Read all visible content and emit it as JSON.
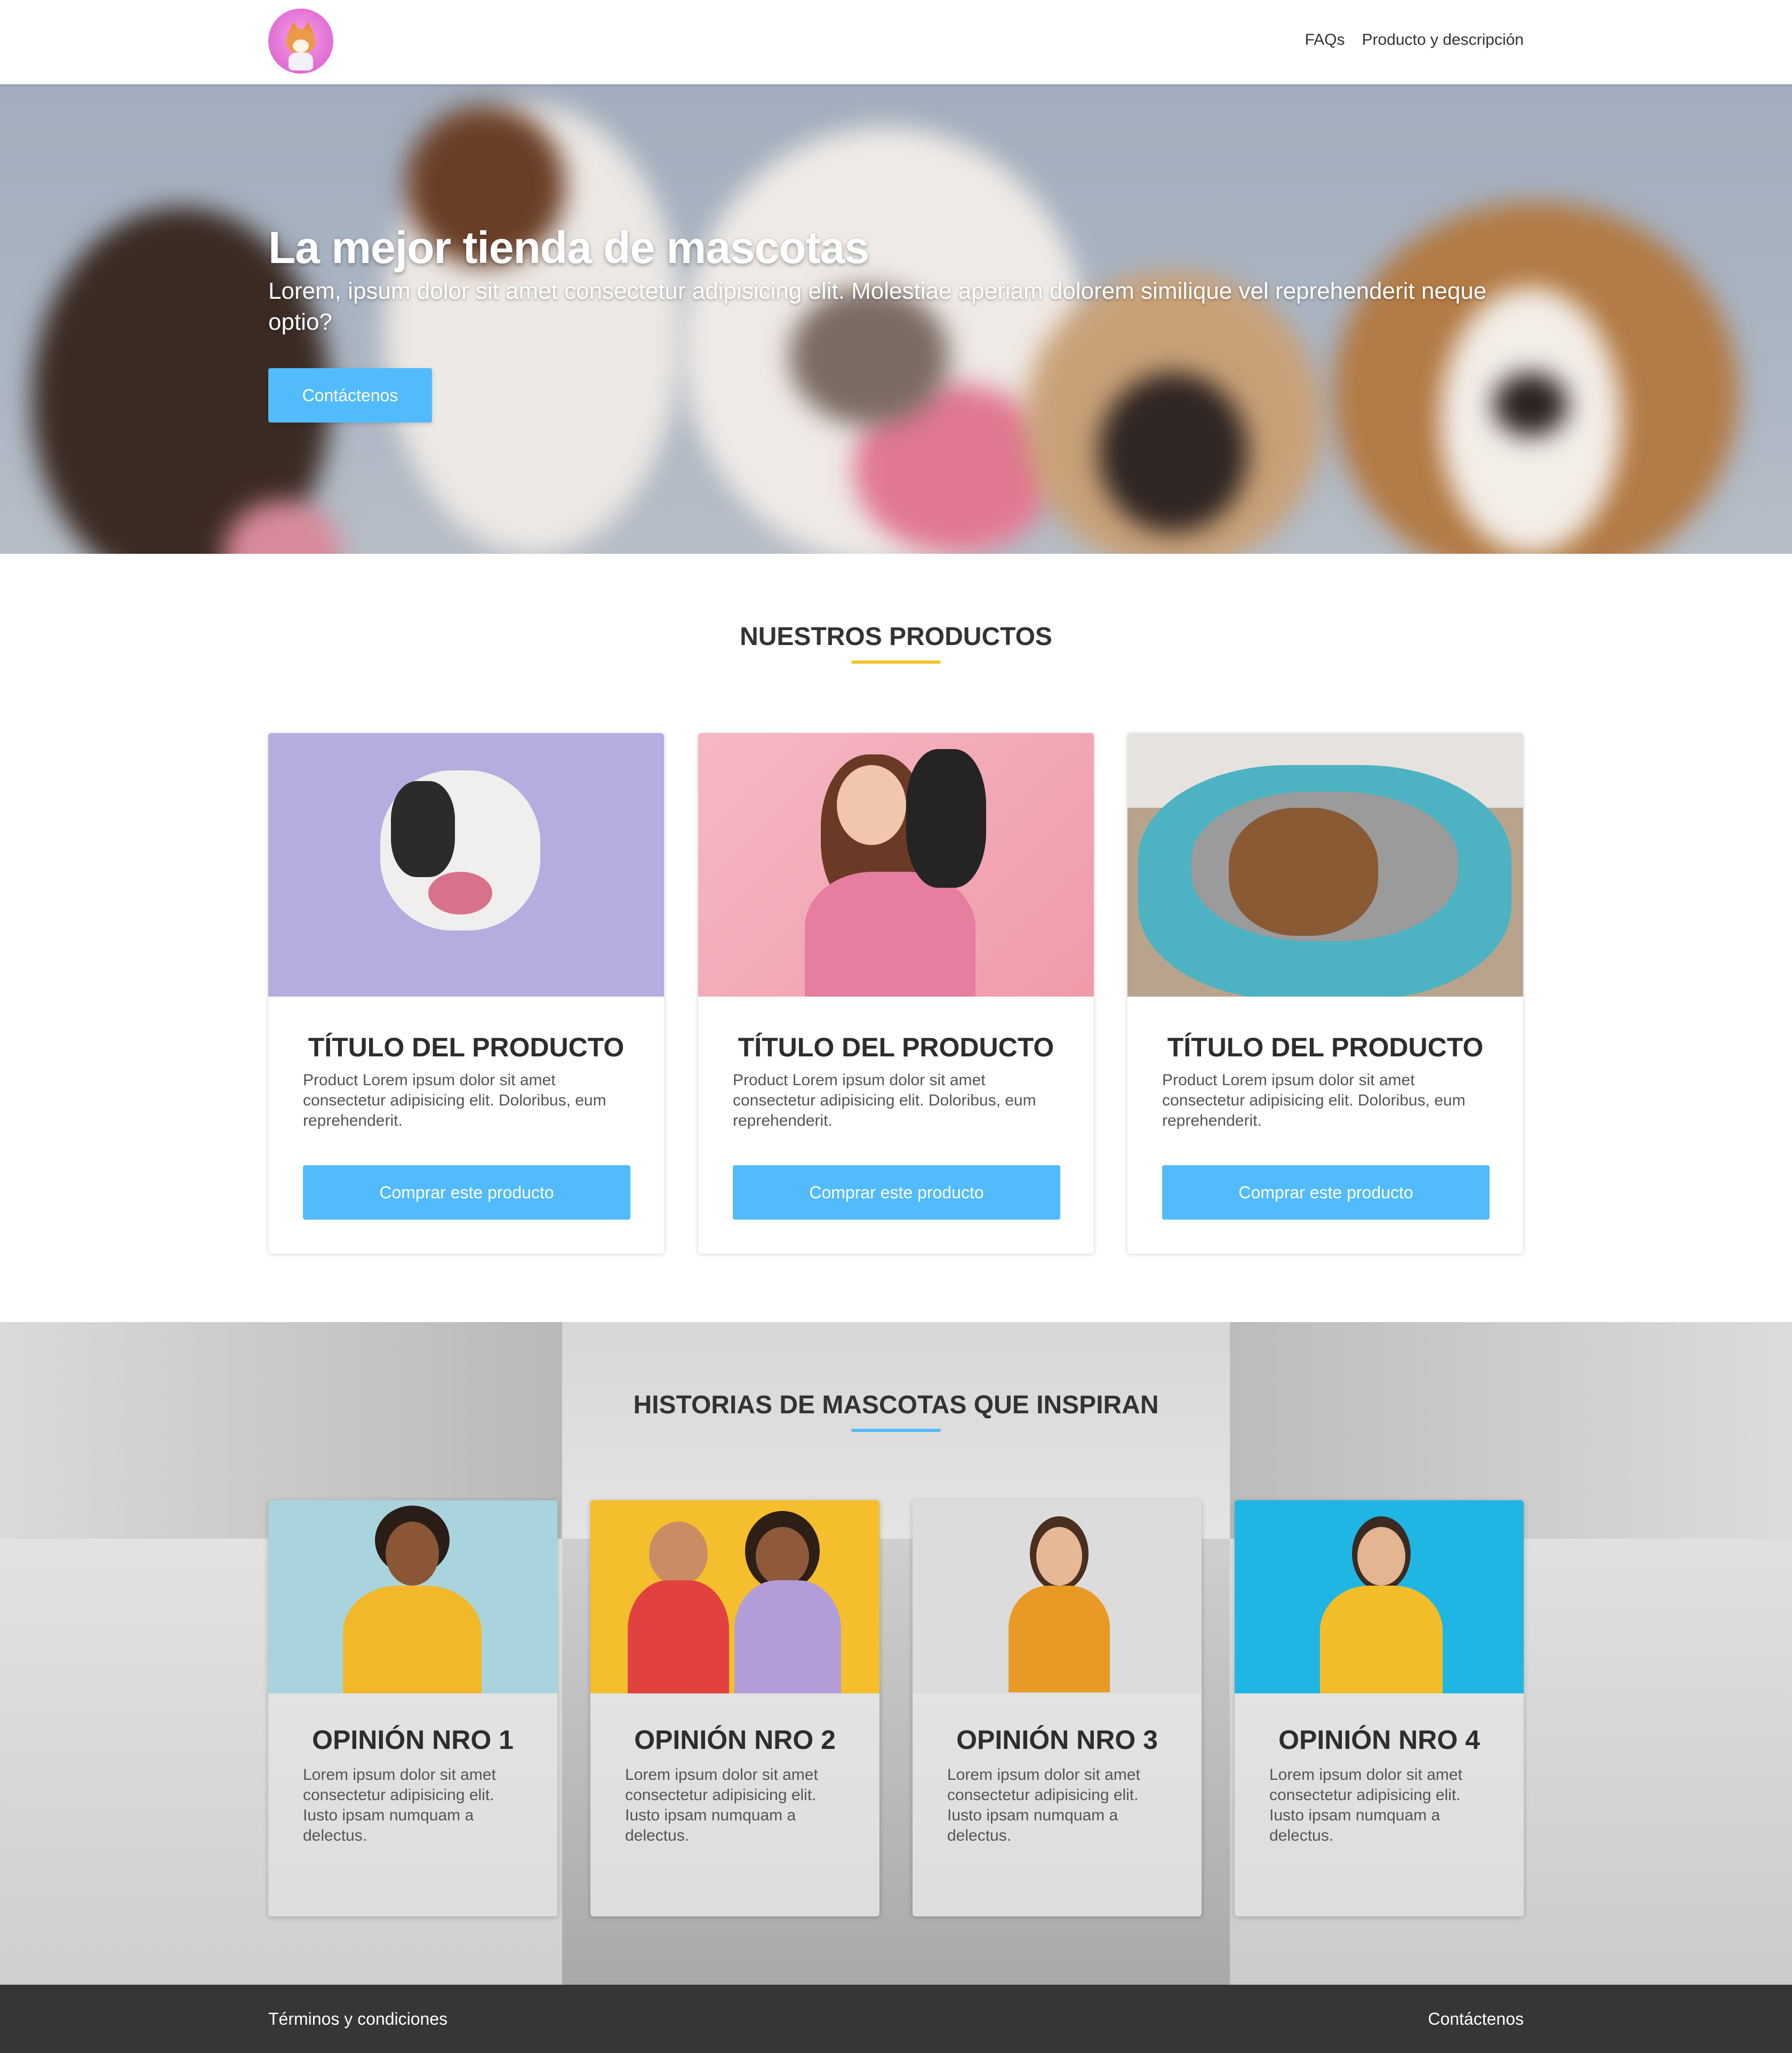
{
  "nav": {
    "faqs": "FAQs",
    "product": "Producto y descripción"
  },
  "hero": {
    "title": "La mejor tienda de mascotas",
    "subtitle": "Lorem, ipsum dolor sit amet consectetur adipisicing elit. Molestiae aperiam dolorem similique vel reprehenderit neque optio?",
    "button": "Contáctenos"
  },
  "products": {
    "title": "NUESTROS PRODUCTOS",
    "accent": "#f5c528",
    "items": [
      {
        "title": "TÍTULO DEL PRODUCTO",
        "desc": "Product Lorem ipsum dolor sit amet consectetur adipisicing elit. Doloribus, eum reprehenderit.",
        "button": "Comprar este producto"
      },
      {
        "title": "TÍTULO DEL PRODUCTO",
        "desc": "Product Lorem ipsum dolor sit amet consectetur adipisicing elit. Doloribus, eum reprehenderit.",
        "button": "Comprar este producto"
      },
      {
        "title": "TÍTULO DEL PRODUCTO",
        "desc": "Product Lorem ipsum dolor sit amet consectetur adipisicing elit. Doloribus, eum reprehenderit.",
        "button": "Comprar este producto"
      }
    ]
  },
  "stories": {
    "title": "HISTORIAS DE MASCOTAS QUE INSPIRAN",
    "accent": "#52bbfb",
    "items": [
      {
        "title": "OPINIÓN NRO 1",
        "desc": "Lorem ipsum dolor sit amet consectetur adipisicing elit. Iusto ipsam numquam a delectus."
      },
      {
        "title": "OPINIÓN NRO 2",
        "desc": "Lorem ipsum dolor sit amet consectetur adipisicing elit. Iusto ipsam numquam a delectus."
      },
      {
        "title": "OPINIÓN NRO 3",
        "desc": "Lorem ipsum dolor sit amet consectetur adipisicing elit. Iusto ipsam numquam a delectus."
      },
      {
        "title": "OPINIÓN NRO 4",
        "desc": "Lorem ipsum dolor sit amet consectetur adipisicing elit. Iusto ipsam numquam a delectus."
      }
    ]
  },
  "footer": {
    "terms": "Términos y condiciones",
    "contact": "Contáctenos"
  },
  "colors": {
    "button": "#52bbfb",
    "footer": "#363636"
  }
}
